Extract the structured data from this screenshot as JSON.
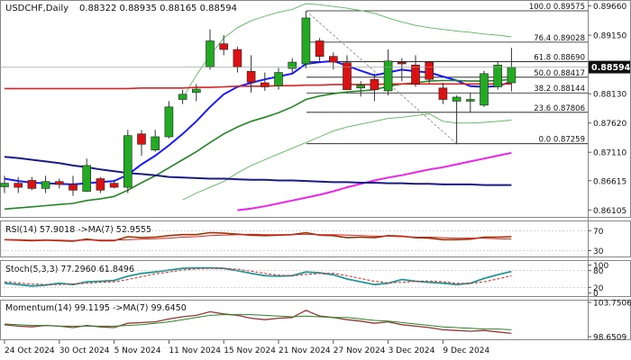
{
  "header": {
    "symbol_tf": "USDCHF,Daily",
    "ohlc": "0.88322 0.88935 0.88165 0.88594"
  },
  "colors": {
    "bull": "#22aa22",
    "bear": "#dd1111",
    "ma_blue": "#1a1aff",
    "ma_green": "#228822",
    "ma_red": "#dd2222",
    "ma_magenta": "#ee22ee",
    "ma_navy": "#1a1a88",
    "bollinger": "#55bb55",
    "fib": "#111111",
    "price_tag_bg": "#111111",
    "price_tag_text": "#ffffff",
    "rsi": "#993300",
    "rsi_ma": "#dd2222",
    "stoch_main": "#229999",
    "stoch_signal": "#dd2222",
    "mom": "#993333",
    "mom_ma": "#228822"
  },
  "chart_data": [
    {
      "type": "candlestick",
      "title": "USDCHF,Daily",
      "ylim": [
        0.86,
        0.897
      ],
      "y_ticks": [
        "0.89660",
        "0.89150",
        "0.88130",
        "0.87620",
        "0.87110",
        "0.86615",
        "0.86105"
      ],
      "current_price": "0.88594",
      "x_tick_labels": [
        {
          "i": 0,
          "label": "24 Oct 2024"
        },
        {
          "i": 4,
          "label": "30 Oct 2024"
        },
        {
          "i": 8,
          "label": "5 Nov 2024"
        },
        {
          "i": 12,
          "label": "11 Nov 2024"
        },
        {
          "i": 16,
          "label": "15 Nov 2024"
        },
        {
          "i": 20,
          "label": "21 Nov 2024"
        },
        {
          "i": 24,
          "label": "27 Nov 2024"
        },
        {
          "i": 28,
          "label": "3 Dec 2024"
        },
        {
          "i": 32,
          "label": "9 Dec 2024"
        }
      ],
      "candles": [
        {
          "o": 0.8651,
          "h": 0.867,
          "l": 0.864,
          "c": 0.8657
        },
        {
          "o": 0.8657,
          "h": 0.8668,
          "l": 0.864,
          "c": 0.865
        },
        {
          "o": 0.8662,
          "h": 0.8668,
          "l": 0.8645,
          "c": 0.8648
        },
        {
          "o": 0.8648,
          "h": 0.867,
          "l": 0.864,
          "c": 0.866
        },
        {
          "o": 0.866,
          "h": 0.8665,
          "l": 0.8648,
          "c": 0.8655
        },
        {
          "o": 0.8655,
          "h": 0.867,
          "l": 0.8635,
          "c": 0.8645
        },
        {
          "o": 0.8643,
          "h": 0.87,
          "l": 0.8642,
          "c": 0.8688
        },
        {
          "o": 0.8665,
          "h": 0.8668,
          "l": 0.864,
          "c": 0.8645
        },
        {
          "o": 0.8657,
          "h": 0.8663,
          "l": 0.8648,
          "c": 0.865
        },
        {
          "o": 0.865,
          "h": 0.875,
          "l": 0.864,
          "c": 0.874
        },
        {
          "o": 0.8743,
          "h": 0.875,
          "l": 0.8705,
          "c": 0.8725
        },
        {
          "o": 0.8715,
          "h": 0.875,
          "l": 0.8712,
          "c": 0.8738
        },
        {
          "o": 0.8738,
          "h": 0.88,
          "l": 0.8735,
          "c": 0.879
        },
        {
          "o": 0.8803,
          "h": 0.882,
          "l": 0.8795,
          "c": 0.8812
        },
        {
          "o": 0.8815,
          "h": 0.883,
          "l": 0.88,
          "c": 0.8821
        },
        {
          "o": 0.886,
          "h": 0.8925,
          "l": 0.8855,
          "c": 0.8905
        },
        {
          "o": 0.89,
          "h": 0.8915,
          "l": 0.888,
          "c": 0.889
        },
        {
          "o": 0.889,
          "h": 0.8895,
          "l": 0.885,
          "c": 0.886
        },
        {
          "o": 0.8852,
          "h": 0.888,
          "l": 0.8815,
          "c": 0.8833
        },
        {
          "o": 0.8832,
          "h": 0.885,
          "l": 0.8818,
          "c": 0.8825
        },
        {
          "o": 0.8827,
          "h": 0.8858,
          "l": 0.882,
          "c": 0.885
        },
        {
          "o": 0.8857,
          "h": 0.8875,
          "l": 0.8848,
          "c": 0.8868
        },
        {
          "o": 0.8865,
          "h": 0.8957,
          "l": 0.8857,
          "c": 0.8945
        },
        {
          "o": 0.8905,
          "h": 0.891,
          "l": 0.887,
          "c": 0.8878
        },
        {
          "o": 0.8878,
          "h": 0.8885,
          "l": 0.8855,
          "c": 0.8868
        },
        {
          "o": 0.8867,
          "h": 0.888,
          "l": 0.884,
          "c": 0.882
        },
        {
          "o": 0.8823,
          "h": 0.8835,
          "l": 0.8808,
          "c": 0.8828
        },
        {
          "o": 0.8838,
          "h": 0.8848,
          "l": 0.88,
          "c": 0.882
        },
        {
          "o": 0.8818,
          "h": 0.889,
          "l": 0.881,
          "c": 0.887
        },
        {
          "o": 0.8868,
          "h": 0.8875,
          "l": 0.8835,
          "c": 0.8865
        },
        {
          "o": 0.8863,
          "h": 0.888,
          "l": 0.8825,
          "c": 0.883
        },
        {
          "o": 0.8868,
          "h": 0.887,
          "l": 0.883,
          "c": 0.8838
        },
        {
          "o": 0.8823,
          "h": 0.8832,
          "l": 0.8795,
          "c": 0.8803
        },
        {
          "o": 0.88,
          "h": 0.881,
          "l": 0.8725,
          "c": 0.8807
        },
        {
          "o": 0.88,
          "h": 0.8815,
          "l": 0.878,
          "c": 0.8803
        },
        {
          "o": 0.8793,
          "h": 0.8853,
          "l": 0.879,
          "c": 0.8848
        },
        {
          "o": 0.8825,
          "h": 0.887,
          "l": 0.882,
          "c": 0.8863
        },
        {
          "o": 0.8832,
          "h": 0.8893,
          "l": 0.8817,
          "c": 0.8859
        }
      ],
      "fib_levels": [
        {
          "label": "100.0 0.89575",
          "value": 0.89575
        },
        {
          "label": "76.4 0.89028",
          "value": 0.89028
        },
        {
          "label": "61.8 0.88690",
          "value": 0.8869
        },
        {
          "label": "50.0 0.88417",
          "value": 0.88417
        },
        {
          "label": "38.2 0.88144",
          "value": 0.88144
        },
        {
          "label": "23.6 0.87806",
          "value": 0.87806
        },
        {
          "label": "0.0 0.87259",
          "value": 0.87259
        }
      ],
      "moving_averages": [
        {
          "color_key": "ma_blue",
          "values": [
            0.8665,
            0.8661,
            0.8658,
            0.8657,
            0.8656,
            0.8655,
            0.8657,
            0.8659,
            0.8661,
            0.8672,
            0.869,
            0.8705,
            0.8723,
            0.8743,
            0.8765,
            0.879,
            0.8812,
            0.8825,
            0.8832,
            0.8838,
            0.8843,
            0.8848,
            0.8865,
            0.8868,
            0.887,
            0.8862,
            0.8853,
            0.8845,
            0.885,
            0.8855,
            0.8852,
            0.885,
            0.8843,
            0.8836,
            0.8826,
            0.8825,
            0.8826,
            0.8834
          ]
        },
        {
          "color_key": "ma_green",
          "values": [
            0.8612,
            0.8614,
            0.8616,
            0.8618,
            0.862,
            0.8622,
            0.8627,
            0.863,
            0.8634,
            0.8645,
            0.8658,
            0.867,
            0.8684,
            0.8698,
            0.8712,
            0.8728,
            0.8743,
            0.8755,
            0.8765,
            0.8772,
            0.878,
            0.879,
            0.8803,
            0.8809,
            0.8813,
            0.8816,
            0.8818,
            0.882,
            0.8826,
            0.883,
            0.8832,
            0.8835,
            0.8836,
            0.8836,
            0.8835,
            0.8835,
            0.8836,
            0.8838
          ]
        },
        {
          "color_key": "ma_red",
          "values": [
            0.8822,
            0.8822,
            0.8822,
            0.8822,
            0.8822,
            0.8822,
            0.8822,
            0.8822,
            0.8822,
            0.8822,
            0.8823,
            0.8823,
            0.8823,
            0.8823,
            0.8824,
            0.8824,
            0.8825,
            0.8826,
            0.8826,
            0.8826,
            0.8827,
            0.8827,
            0.8828,
            0.8828,
            0.8829,
            0.8829,
            0.8829,
            0.8829,
            0.883,
            0.883,
            0.883,
            0.883,
            0.883,
            0.883,
            0.883,
            0.883,
            0.883,
            0.883
          ]
        },
        {
          "color_key": "ma_magenta",
          "values": [
            null,
            null,
            null,
            null,
            null,
            null,
            null,
            null,
            null,
            null,
            null,
            null,
            null,
            null,
            null,
            null,
            null,
            0.861,
            0.8613,
            0.8617,
            0.8622,
            0.8627,
            0.8632,
            0.8637,
            0.8643,
            0.865,
            0.8656,
            0.8662,
            0.8667,
            0.8671,
            0.8676,
            0.8681,
            0.8685,
            0.869,
            0.8695,
            0.87,
            0.8705,
            0.871
          ]
        },
        {
          "color_key": "ma_navy",
          "values": [
            0.8703,
            0.8701,
            0.8698,
            0.8695,
            0.8692,
            0.8688,
            0.8685,
            0.8681,
            0.8678,
            0.8675,
            0.8673,
            0.8671,
            0.8668,
            0.8667,
            0.8666,
            0.8665,
            0.8665,
            0.8664,
            0.8663,
            0.8663,
            0.8662,
            0.8662,
            0.8661,
            0.866,
            0.8659,
            0.8659,
            0.8658,
            0.8658,
            0.8657,
            0.8657,
            0.8656,
            0.8656,
            0.8655,
            0.8655,
            0.8655,
            0.8654,
            0.8654,
            0.8654
          ]
        }
      ],
      "bollinger_upper": [
        null,
        null,
        null,
        null,
        null,
        null,
        null,
        null,
        null,
        null,
        null,
        null,
        null,
        0.8805,
        0.8845,
        0.888,
        0.891,
        0.8928,
        0.894,
        0.8948,
        0.8955,
        0.896,
        0.897,
        0.8968,
        0.8965,
        0.8962,
        0.8958,
        0.8953,
        0.8945,
        0.8938,
        0.8932,
        0.8928,
        0.8925,
        0.8922,
        0.892,
        0.8917,
        0.8915,
        0.8912
      ],
      "bollinger_lower": [
        null,
        null,
        null,
        null,
        null,
        null,
        null,
        null,
        null,
        null,
        null,
        null,
        null,
        0.8628,
        0.864,
        0.865,
        0.866,
        0.8675,
        0.8688,
        0.8698,
        0.8708,
        0.8718,
        0.8728,
        0.8738,
        0.8748,
        0.8755,
        0.876,
        0.8765,
        0.877,
        0.8772,
        0.8775,
        0.8778,
        0.8765,
        0.8762,
        0.8762,
        0.8763,
        0.8765,
        0.8767
      ]
    },
    {
      "type": "line",
      "title": "RSI(14) 57.9018 ->MA(7) 52.9555",
      "ylim": [
        20,
        85
      ],
      "y_ticks": [
        "70",
        "30"
      ],
      "series": [
        {
          "name": "RSI(14)",
          "values": [
            52,
            51,
            50,
            51,
            50,
            49,
            53,
            50,
            50,
            58,
            56,
            57,
            60,
            62,
            62,
            66,
            65,
            63,
            61,
            60,
            61,
            62,
            66,
            61,
            60,
            56,
            57,
            56,
            60,
            59,
            56,
            55,
            52,
            52,
            53,
            57,
            57,
            58
          ]
        },
        {
          "name": "MA(7)",
          "values": [
            52,
            52,
            51,
            51,
            51,
            50,
            51,
            51,
            51,
            52,
            53,
            54,
            55,
            57,
            58,
            60,
            61,
            62,
            63,
            62,
            62,
            62,
            63,
            62,
            62,
            61,
            60,
            59,
            59,
            58,
            57,
            57,
            56,
            55,
            55,
            55,
            54,
            53
          ]
        }
      ]
    },
    {
      "type": "line",
      "title": "Stoch(5,3,3) 77.2960 61.8496",
      "ylim": [
        -8,
        108
      ],
      "y_ticks": [
        "100",
        "80",
        "20",
        "0"
      ],
      "series": [
        {
          "name": "%K",
          "values": [
            35,
            30,
            25,
            28,
            35,
            30,
            40,
            42,
            45,
            60,
            70,
            75,
            82,
            88,
            90,
            90,
            88,
            80,
            70,
            62,
            60,
            62,
            75,
            72,
            65,
            50,
            40,
            30,
            35,
            48,
            42,
            38,
            35,
            30,
            35,
            52,
            65,
            77
          ]
        },
        {
          "name": "%D",
          "values": [
            40,
            36,
            32,
            30,
            30,
            32,
            35,
            38,
            40,
            48,
            58,
            68,
            75,
            82,
            86,
            88,
            88,
            85,
            78,
            70,
            64,
            62,
            66,
            70,
            70,
            62,
            52,
            42,
            36,
            38,
            42,
            43,
            40,
            35,
            34,
            40,
            50,
            62
          ]
        }
      ]
    },
    {
      "type": "line",
      "title": "Momentum(14) 99.1195 ->MA(7) 99.6450",
      "ylim": [
        98.4,
        103.4
      ],
      "y_ticks": [
        "103.7506",
        "98.6509"
      ],
      "series": [
        {
          "name": "Momentum(14)",
          "values": [
            100.3,
            100.1,
            100.0,
            100.2,
            100.1,
            99.9,
            100.2,
            100.0,
            99.9,
            100.5,
            100.6,
            100.7,
            101.1,
            101.4,
            101.6,
            102.1,
            101.8,
            101.6,
            101.2,
            101.0,
            101.2,
            101.3,
            102.3,
            101.5,
            101.3,
            101.0,
            100.8,
            100.5,
            100.7,
            100.3,
            100.1,
            99.9,
            99.6,
            99.5,
            99.4,
            99.5,
            99.3,
            99.1
          ]
        },
        {
          "name": "MA(7)",
          "values": [
            100.4,
            100.3,
            100.2,
            100.2,
            100.1,
            100.1,
            100.1,
            100.1,
            100.1,
            100.2,
            100.3,
            100.5,
            100.7,
            101.0,
            101.3,
            101.6,
            101.7,
            101.7,
            101.7,
            101.6,
            101.5,
            101.4,
            101.5,
            101.4,
            101.3,
            101.3,
            101.1,
            100.9,
            100.8,
            100.6,
            100.4,
            100.2,
            100.0,
            99.9,
            99.8,
            99.7,
            99.7,
            99.6
          ]
        }
      ]
    }
  ]
}
